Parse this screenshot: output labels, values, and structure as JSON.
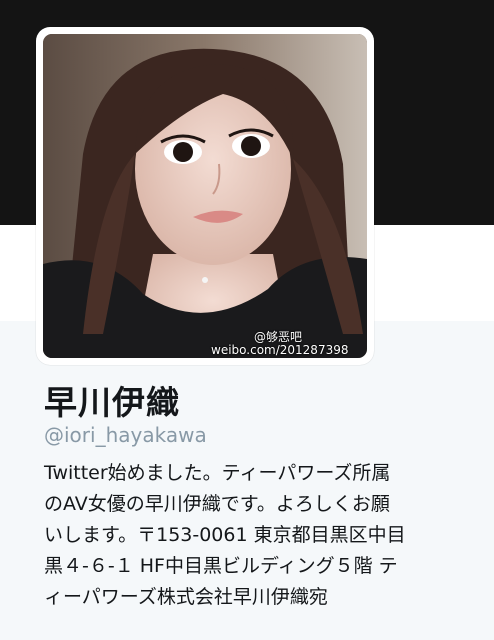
{
  "profile": {
    "display_name": "早川伊織",
    "screen_name": "@iori_hayakawa",
    "bio_lines": [
      "Twitter始めました。ティーパワーズ所属",
      "のAV女優の早川伊織です。よろしくお願",
      "いします。〒153-0061 東京都目黒区中目",
      "黒４-６-１ HF中目黒ビルディング５階 テ",
      "ィーパワーズ株式会社早川伊織宛"
    ]
  },
  "watermark": {
    "handle": "@够恶吧",
    "url": "weibo.com/201287398"
  },
  "colors": {
    "header": "#141414",
    "background": "#f5f8fa",
    "name_text": "#14171a",
    "handle_text": "#8899a6"
  }
}
